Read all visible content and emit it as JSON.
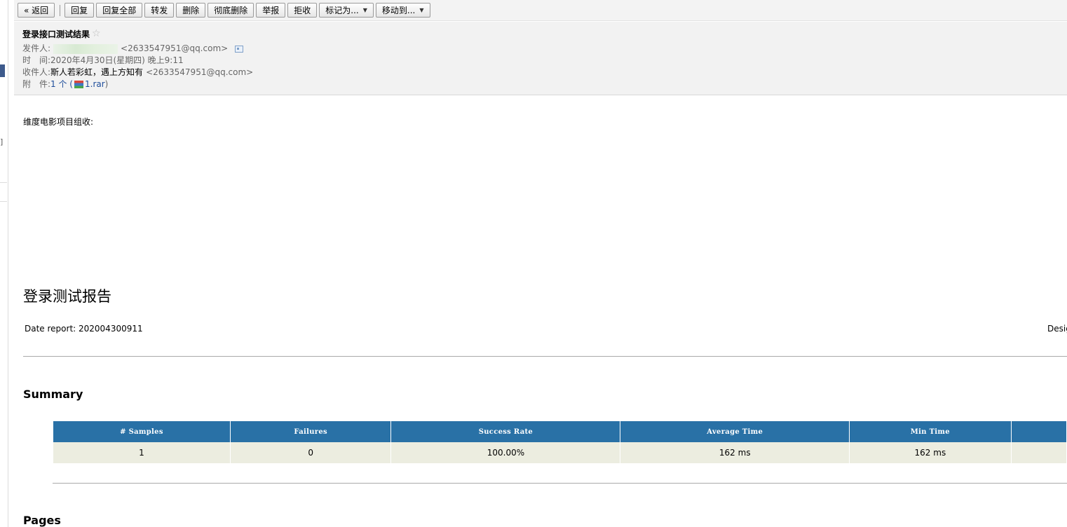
{
  "toolbar": {
    "back": "« 返回",
    "reply": "回复",
    "reply_all": "回复全部",
    "forward": "转发",
    "delete": "删除",
    "delete_forever": "彻底删除",
    "report": "举报",
    "reject": "拒收",
    "mark_as": "标记为...",
    "move_to": "移动到..."
  },
  "header": {
    "subject": "登录接口测试结果",
    "sender_label": "发件人:",
    "sender_email": "<2633547951@qq.com>",
    "time_label": "时　间:",
    "time_value": "2020年4月30日(星期四) 晚上9:11",
    "to_label": "收件人:",
    "to_name": "斯人若彩虹，遇上方知有",
    "to_email": "<2633547951@qq.com>",
    "attach_label": "附　件:",
    "attach_count": "1 个 (",
    "attach_name": "1.rar",
    "attach_close": ")"
  },
  "body": {
    "greeting": "维度电影项目组收:",
    "report_title": "登录测试报告",
    "date_report": "Date report: 202004300911",
    "designer_cut": "Desig",
    "summary_heading": "Summary",
    "pages_heading": "Pages"
  },
  "summary_table": {
    "headers": [
      "# Samples",
      "Failures",
      "Success Rate",
      "Average Time",
      "Min Time"
    ],
    "row": [
      "1",
      "0",
      "100.00%",
      "162 ms",
      "162 ms"
    ]
  },
  "colors": {
    "table_header": "#2971a6",
    "table_row": "#ecede0",
    "header_bg": "#f2f2f2"
  }
}
